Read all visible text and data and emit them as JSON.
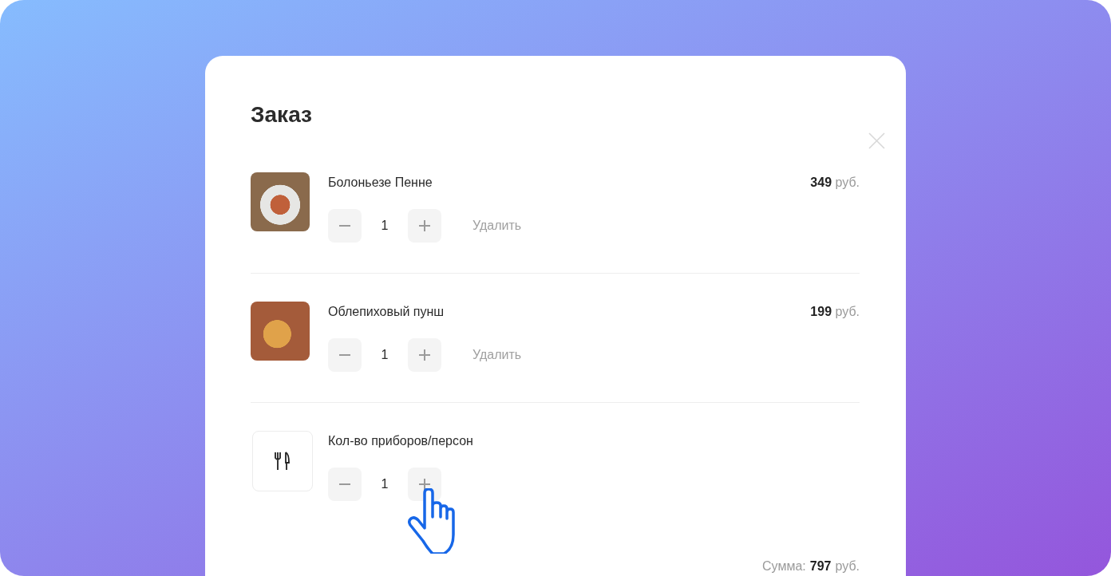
{
  "order": {
    "title": "Заказ",
    "items": [
      {
        "kind": "food",
        "name": "Болоньезе Пенне",
        "quantity": "1",
        "price": "349",
        "currency": "руб.",
        "remove": "Удалить"
      },
      {
        "kind": "food",
        "name": "Облепиховый пунш",
        "quantity": "1",
        "price": "199",
        "currency": "руб.",
        "remove": "Удалить"
      },
      {
        "kind": "cutlery",
        "name": "Кол-во приборов/персон",
        "quantity": "1"
      }
    ],
    "total": {
      "label": "Сумма:",
      "amount": "797",
      "currency": "руб."
    }
  }
}
